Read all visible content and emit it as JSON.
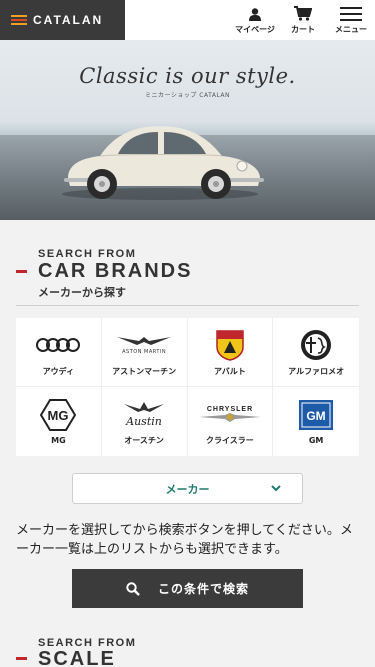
{
  "header": {
    "logo_text": "CATALAN",
    "account_label": "マイページ",
    "cart_label": "カート",
    "menu_label": "メニュー"
  },
  "hero": {
    "slogan": "Classic is our style.",
    "sub": "ミニカーショップ CATALAN"
  },
  "brands_section": {
    "small_title": "SEARCH FROM",
    "big_title": "CAR BRANDS",
    "jp_title": "メーカーから探す",
    "brands": [
      {
        "name": "アウディ",
        "icon": "audi-logo"
      },
      {
        "name": "アストンマーチン",
        "icon": "aston-martin-logo",
        "logo_text": "ASTON MARTIN"
      },
      {
        "name": "アバルト",
        "icon": "abarth-logo"
      },
      {
        "name": "アルファロメオ",
        "icon": "alfa-romeo-logo"
      },
      {
        "name": "MG",
        "icon": "mg-logo",
        "logo_text": "MG"
      },
      {
        "name": "オースチン",
        "icon": "austin-logo",
        "logo_text": "Austin"
      },
      {
        "name": "クライスラー",
        "icon": "chrysler-logo",
        "logo_text": "CHRYSLER"
      },
      {
        "name": "GM",
        "icon": "gm-logo",
        "logo_text": "GM"
      }
    ],
    "select_value": "メーカー",
    "description": "メーカーを選択してから検索ボタンを押してください。メーカー一覧は上のリストからも選択できます。",
    "search_label": "この条件で検索"
  },
  "scale_section": {
    "small_title": "SEARCH FROM",
    "big_title": "SCALE"
  },
  "colors": {
    "accent_red": "#c0272d",
    "dark": "#3b3b3b",
    "select_text": "#1e7a6a"
  }
}
